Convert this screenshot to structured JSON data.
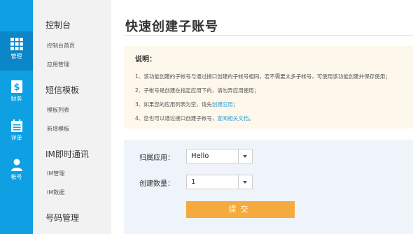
{
  "rail": {
    "items": [
      {
        "label": "管理",
        "icon": "grid-icon"
      },
      {
        "label": "财务",
        "icon": "dollar-icon"
      },
      {
        "label": "详单",
        "icon": "calendar-icon"
      },
      {
        "label": "帐号",
        "icon": "user-icon"
      }
    ],
    "active": "管理"
  },
  "menu": {
    "groups": [
      {
        "title": "控制台",
        "links": [
          "控制台首页",
          "应用管理"
        ]
      },
      {
        "title": "短信模板",
        "links": [
          "模板列表",
          "新增模板"
        ]
      },
      {
        "title": "IM即时通讯",
        "links": [
          "IM管理",
          "IM数据"
        ]
      },
      {
        "title": "号码管理",
        "links": []
      }
    ]
  },
  "page": {
    "title": "快速创建子账号"
  },
  "notice": {
    "title": "说明：",
    "lines": [
      {
        "text": "1、该功能创建的子帐号与通过接口创建的子帐号相同，若不需要太多子帐号，可使用该功能创建并保存使用；"
      },
      {
        "text": "2、子帐号是创建在指定应用下的，请勿弄应用使用；"
      },
      {
        "text": "3、如果您的应用列表为空，请先",
        "link": "创建应用",
        "suffix": "；"
      },
      {
        "text": "4、您也可以通过接口创建子帐号，",
        "link": "查阅相关文档",
        "suffix": "。"
      }
    ]
  },
  "form": {
    "app_label": "归属应用：",
    "app_value": "Hello",
    "count_label": "创建数量：",
    "count_value": "1",
    "submit_label": "提交"
  },
  "colors": {
    "rail": "#0ea0e2",
    "rail_active": "#0b86c9",
    "submit": "#f4aa3c",
    "link": "#2a9fd8",
    "notice_bg": "#fdf7ec",
    "form_bg": "#eef4fa"
  }
}
